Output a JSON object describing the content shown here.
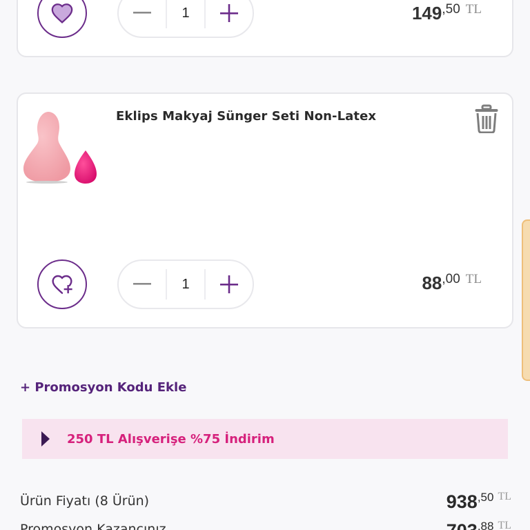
{
  "cart": {
    "items": [
      {
        "title": "",
        "quantity": "1",
        "price_int": "149",
        "price_dec": ",50",
        "currency": "TL",
        "favorited": true
      },
      {
        "title": "Eklips Makyaj Sünger Seti Non-Latex",
        "quantity": "1",
        "price_int": "88",
        "price_dec": ",00",
        "currency": "TL",
        "favorited": false
      }
    ]
  },
  "promo": {
    "add_code_label": "+ Promosyon Kodu Ekle"
  },
  "campaign": {
    "label": "250 TL Alışverişe %75 İndirim"
  },
  "summary": {
    "product_price_label": "Ürün Fiyatı (8 Ürün)",
    "product_price_int": "938",
    "product_price_dec": ",50",
    "product_price_currency": "TL",
    "promo_gain_label": "Promosyon Kazancınız",
    "promo_gain_int": "703",
    "promo_gain_dec": ",88",
    "promo_gain_currency": "TL"
  },
  "colors": {
    "accent_purple": "#6b2c8a",
    "campaign_bg": "#f8e3ef",
    "campaign_text": "#d6217c",
    "promo_link": "#55237a"
  },
  "icons": {
    "favorite_filled": "heart-filled-icon",
    "favorite_add": "heart-plus-icon",
    "decrease": "minus-icon",
    "increase": "plus-icon",
    "delete": "trash-icon",
    "campaign_expand": "caret-right-icon"
  }
}
